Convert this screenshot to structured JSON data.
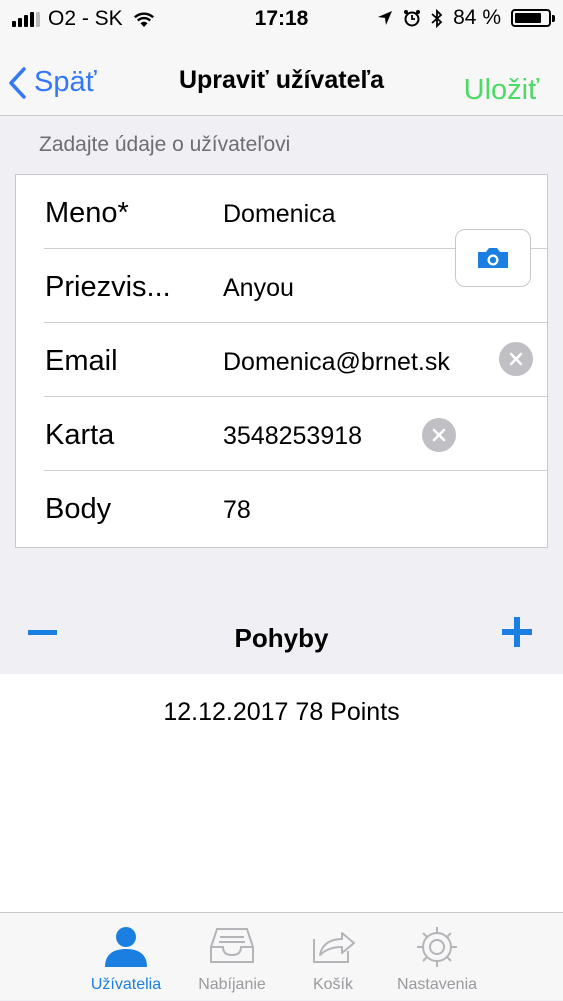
{
  "status_bar": {
    "carrier": "O2 - SK",
    "time": "17:18",
    "battery_percent": "84 %",
    "battery_level": 0.84
  },
  "nav": {
    "back_label": "Späť",
    "title": "Upraviť užívateľa",
    "save_label": "Uložiť"
  },
  "form": {
    "section_header": "Zadajte údaje o užívateľovi",
    "fields": [
      {
        "label": "Meno*",
        "value": "Domenica"
      },
      {
        "label": "Priezvis...",
        "value": "Anyou"
      },
      {
        "label": "Email",
        "value": "Domenica@brnet.sk"
      },
      {
        "label": "Karta",
        "value": "3548253918"
      },
      {
        "label": "Body",
        "value": "78"
      }
    ]
  },
  "moves": {
    "title": "Pohyby",
    "items": [
      {
        "text": "12.12.2017  78 Points"
      }
    ]
  },
  "tabbar": {
    "tabs": [
      {
        "label": "Užívatelia",
        "icon": "person-icon",
        "active": true
      },
      {
        "label": "Nabíjanie",
        "icon": "inbox-tray-icon",
        "active": false
      },
      {
        "label": "Košík",
        "icon": "share-box-icon",
        "active": false
      },
      {
        "label": "Nastavenia",
        "icon": "gear-icon",
        "active": false
      }
    ]
  },
  "colors": {
    "accent": "#1a7fe0",
    "back_link": "#3478f6",
    "save": "#4cd964"
  }
}
